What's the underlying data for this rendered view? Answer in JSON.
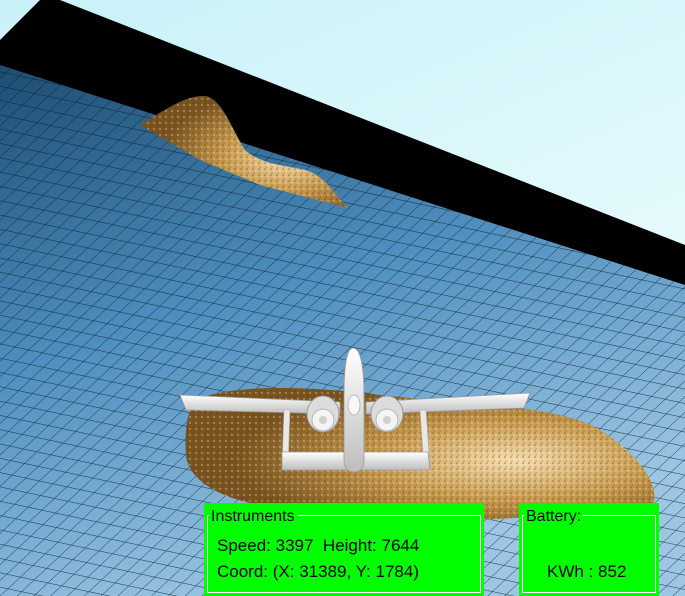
{
  "instruments": {
    "title": "Instruments",
    "speed_label": "Speed:",
    "speed_value": "3397",
    "height_label": "Height:",
    "height_value": "7644",
    "coord_label": "Coord:",
    "coord_x_label": "X:",
    "coord_x_value": "31389",
    "coord_y_label": "Y:",
    "coord_y_value": "1784"
  },
  "battery": {
    "title": "Battery:",
    "kwh_label": "KWh :",
    "kwh_value": "852"
  },
  "colors": {
    "hud_panel": "#00ff00",
    "sky": "#d8f7fb",
    "ocean": "#3a7fae",
    "terrain": "#c9a15a",
    "aircraft": "#f2f2f2"
  },
  "icons": {
    "aircraft": "jet-aircraft-icon"
  }
}
